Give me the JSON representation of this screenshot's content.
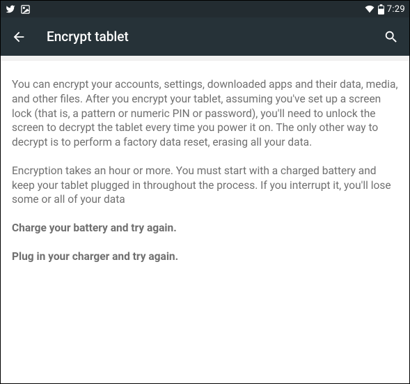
{
  "statusbar": {
    "clock": "7:29"
  },
  "appbar": {
    "title": "Encrypt tablet"
  },
  "content": {
    "p1": "You can encrypt your accounts, settings, downloaded apps and their data, media, and other files. After you encrypt your tablet, assuming you've set up a screen lock (that is, a pattern or numeric PIN or password), you'll need to unlock the screen to decrypt the tablet every time you power it on. The only other way to decrypt is to perform a factory data reset, erasing all your data.",
    "p2": "Encryption takes an hour or more. You must start with a charged battery and keep your tablet plugged in throughout the process. If you interrupt it, you'll lose some or all of your data",
    "warn_battery": "Charge your battery and try again.",
    "warn_charger": "Plug in your charger and try again."
  }
}
